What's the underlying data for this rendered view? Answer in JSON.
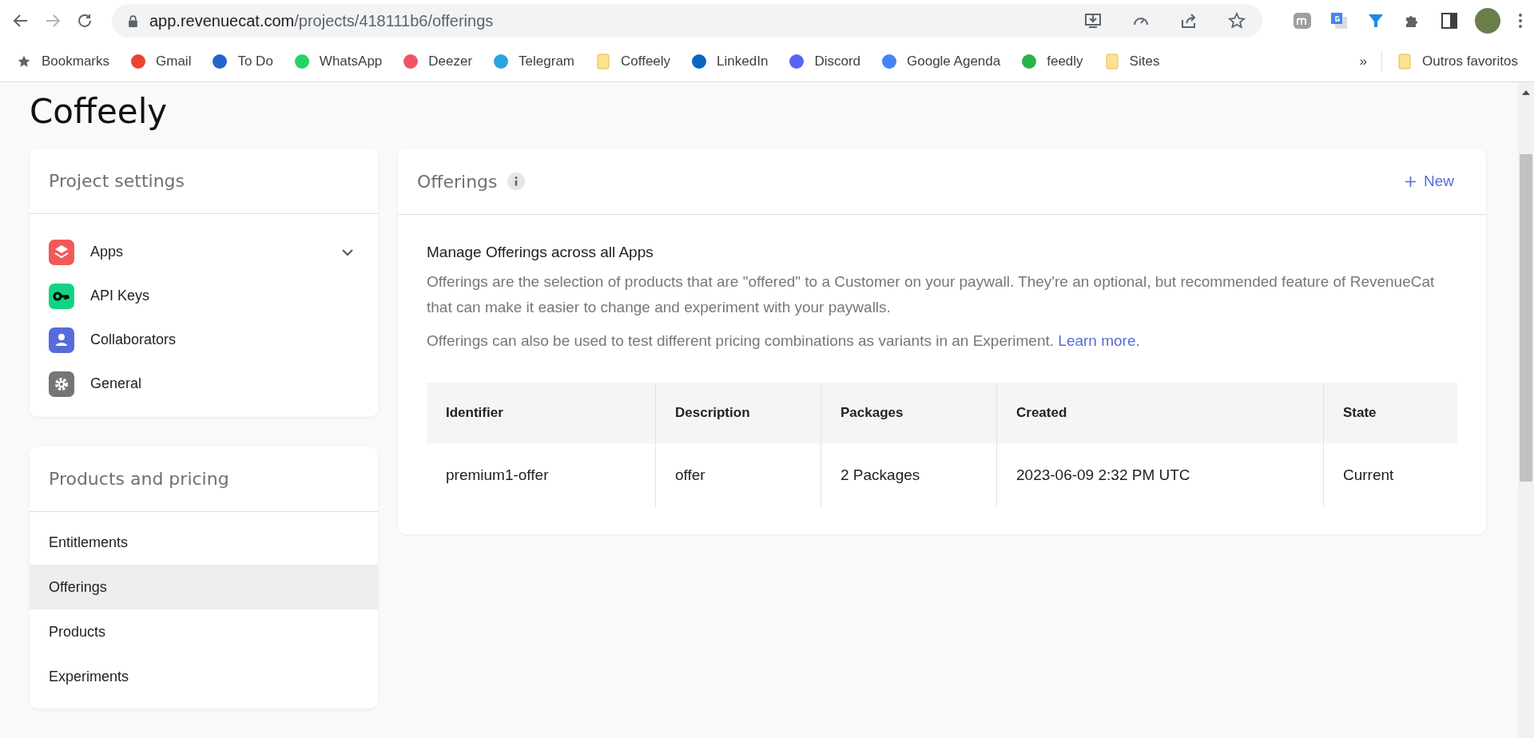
{
  "browser": {
    "url_host": "app.revenuecat.com",
    "url_path": "/projects/418111b6/offerings",
    "bookmarks": [
      {
        "kind": "star",
        "label": "Bookmarks"
      },
      {
        "kind": "favicon",
        "label": "Gmail",
        "color": "#ea4335"
      },
      {
        "kind": "favicon",
        "label": "To Do",
        "color": "#2564cf"
      },
      {
        "kind": "favicon",
        "label": "WhatsApp",
        "color": "#25d366"
      },
      {
        "kind": "favicon",
        "label": "Deezer",
        "color": "#ef5466"
      },
      {
        "kind": "favicon",
        "label": "Telegram",
        "color": "#2aa3df"
      },
      {
        "kind": "folder",
        "label": "Coffeely"
      },
      {
        "kind": "favicon",
        "label": "LinkedIn",
        "color": "#0a66c2"
      },
      {
        "kind": "favicon",
        "label": "Discord",
        "color": "#5865f2"
      },
      {
        "kind": "favicon",
        "label": "Google Agenda",
        "color": "#4285f4"
      },
      {
        "kind": "favicon",
        "label": "feedly",
        "color": "#2bb24c"
      },
      {
        "kind": "folder",
        "label": "Sites"
      }
    ],
    "overflow": "»",
    "other_bookmarks": "Outros favoritos"
  },
  "project_title": "Coffeely",
  "sidebar": [
    {
      "title": "Project settings",
      "items": [
        {
          "label": "Apps",
          "kind": "layers",
          "color": "#f25a5a",
          "expanded": false,
          "selected": false
        },
        {
          "label": "API Keys",
          "kind": "key",
          "color": "#11d483",
          "selected": false
        },
        {
          "label": "Collaborators",
          "kind": "person",
          "color": "#576cdb",
          "selected": false
        },
        {
          "label": "General",
          "kind": "gear",
          "color": "#757575",
          "selected": false
        }
      ]
    },
    {
      "title": "Products and pricing",
      "items": [
        {
          "label": "Entitlements",
          "selected": false
        },
        {
          "label": "Offerings",
          "selected": true
        },
        {
          "label": "Products",
          "selected": false
        },
        {
          "label": "Experiments",
          "selected": false
        }
      ]
    }
  ],
  "panel": {
    "title": "Offerings",
    "new_button": "New",
    "intro_heading": "Manage Offerings across all Apps",
    "paragraphs": [
      "Offerings are the selection of products that are \"offered\" to a Customer on your paywall. They're an optional, but recommended feature of RevenueCat that can make it easier to change and experiment with your paywalls."
    ],
    "last_paragraph": "Offerings can also be used to test different pricing combinations as variants in an Experiment.",
    "link": "Learn more",
    "link_suffix": ".",
    "table": {
      "columns": [
        "Identifier",
        "Description",
        "Packages",
        "Created",
        "State"
      ],
      "rows": [
        [
          "premium1-offer",
          "offer",
          "2 Packages",
          "2023-06-09 2:32 PM UTC",
          "Current"
        ]
      ]
    }
  }
}
